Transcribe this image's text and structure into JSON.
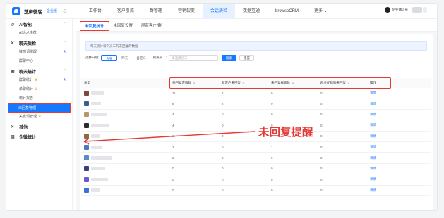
{
  "header": {
    "brand": "芝麻微客",
    "brand_tag": "企业版",
    "collapse_icon": "collapse-icon",
    "nav": [
      {
        "label": "工作台",
        "active": false
      },
      {
        "label": "客户引流",
        "active": false
      },
      {
        "label": "群管理",
        "active": false
      },
      {
        "label": "营销裂变",
        "active": false
      },
      {
        "label": "会话质检",
        "active": true
      },
      {
        "label": "数据互通",
        "active": false
      },
      {
        "label": "browseCRM",
        "active": false
      },
      {
        "label": "更多",
        "active": false
      }
    ],
    "user_name": "企业微信号"
  },
  "sidebar": {
    "groups": [
      {
        "icon": "ai-icon",
        "label": "AI智能",
        "items": [
          {
            "label": "AI话术推荐"
          }
        ]
      },
      {
        "icon": "chat-icon",
        "label": "聊天质检",
        "items": [
          {
            "label": "敏感词提醒"
          },
          {
            "label": "群聊中心"
          }
        ]
      },
      {
        "icon": "chart-icon",
        "label": "聊天统计",
        "items": [
          {
            "label": "群聊统计"
          },
          {
            "label": "单聊统计"
          },
          {
            "label": "统计报告"
          },
          {
            "label": "未回复管理"
          },
          {
            "label": "关键词管理"
          }
        ]
      },
      {
        "icon": "other-icon",
        "label": "其他",
        "items": []
      },
      {
        "icon": "stats-icon",
        "label": "企微统计",
        "items": []
      }
    ]
  },
  "tabs": [
    {
      "label": "未回复统计",
      "active": true
    },
    {
      "label": "未回复设置",
      "active": false
    },
    {
      "label": "屏蔽客户/群",
      "active": false
    }
  ],
  "notice": "每天统计每个员工的未回复的数据",
  "filters": {
    "date_label": "选择日期:",
    "date_options": [
      "今天",
      "昨天",
      "自定义"
    ],
    "member_label": "所属员工:",
    "member_placeholder": "请选择员工",
    "search_label": "搜索",
    "reset_label": "重置"
  },
  "table": {
    "headers": [
      "员工",
      "未回复客服数",
      "新客户未回复",
      "未回复群聊数",
      "群分配群聊未回复",
      "操作"
    ],
    "rows": [
      {
        "values": [
          "11",
          "2",
          "0",
          "0"
        ],
        "action": "详情",
        "avatar_color": "#7a4b3a"
      },
      {
        "values": [
          "6",
          "2",
          "0",
          "0"
        ],
        "action": "详情",
        "avatar_color": "#3b5f8a"
      },
      {
        "values": [
          "4",
          "0",
          "0",
          "0"
        ],
        "action": "详情",
        "avatar_color": "#b8956a"
      },
      {
        "values": [
          "4",
          "0",
          "0",
          "0"
        ],
        "action": "详情",
        "avatar_color": "#2b2b2b"
      },
      {
        "values": [
          "3",
          "0",
          "0",
          "0"
        ],
        "action": "详情",
        "avatar_color": "#8a6a4a"
      },
      {
        "values": [
          "3",
          "0",
          "1",
          "0"
        ],
        "action": "详情",
        "avatar_color": "#4a7ab8"
      },
      {
        "values": [
          "2",
          "0",
          "0",
          "0"
        ],
        "action": "详情",
        "avatar_color": "#5a8ac8"
      },
      {
        "values": [
          "0",
          "0",
          "0",
          "0"
        ],
        "action": "详情",
        "avatar_color": "#3a3f7a"
      },
      {
        "values": [
          "0",
          "0",
          "0",
          "0"
        ],
        "action": "详情",
        "avatar_color": "#6a5acd"
      },
      {
        "values": [
          "0",
          "0",
          "0",
          "0"
        ],
        "action": "详情",
        "avatar_color": "#3d6fd6"
      }
    ]
  },
  "annotation": {
    "text": "未回复提醒",
    "color": "#e53935"
  }
}
